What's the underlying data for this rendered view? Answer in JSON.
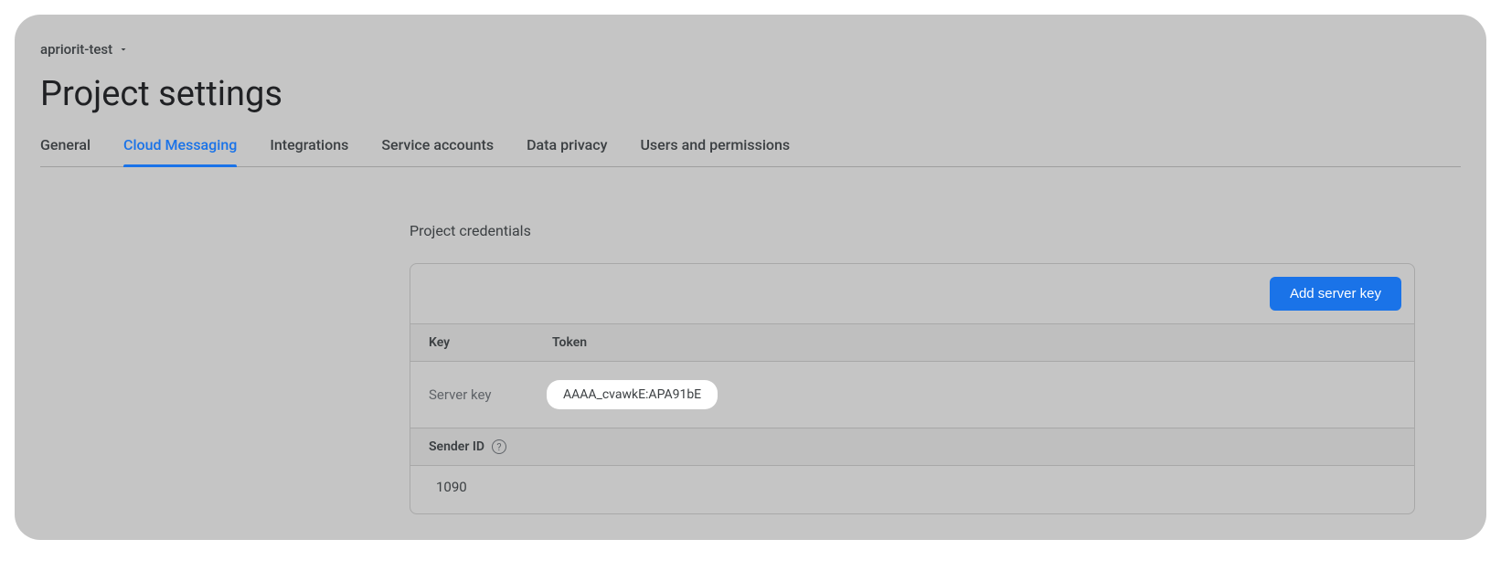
{
  "project": {
    "name": "apriorit-test"
  },
  "page": {
    "title": "Project settings"
  },
  "tabs": [
    {
      "label": "General",
      "active": false
    },
    {
      "label": "Cloud Messaging",
      "active": true
    },
    {
      "label": "Integrations",
      "active": false
    },
    {
      "label": "Service accounts",
      "active": false
    },
    {
      "label": "Data privacy",
      "active": false
    },
    {
      "label": "Users and permissions",
      "active": false
    }
  ],
  "credentials": {
    "section_title": "Project credentials",
    "add_button": "Add server key",
    "columns": {
      "key": "Key",
      "token": "Token"
    },
    "rows": [
      {
        "key": "Server key",
        "token": "AAAA_cvawkE:APA91bE"
      }
    ],
    "sender_id_label": "Sender ID",
    "sender_id_value": "1090"
  }
}
